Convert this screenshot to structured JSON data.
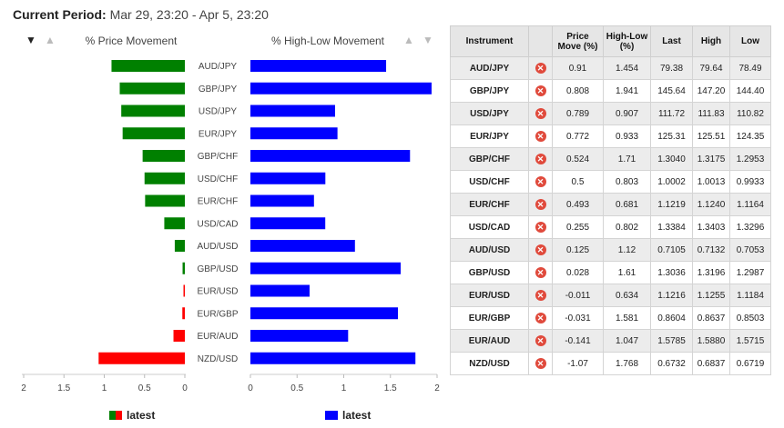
{
  "period": {
    "label": "Current Period:",
    "value": "Mar 29, 23:20 - Apr 5, 23:20"
  },
  "headers": {
    "price": "% Price Movement",
    "highlow": "% High-Low Movement"
  },
  "sort_glyphs": {
    "down": "▼",
    "up": "▲"
  },
  "table": {
    "columns": [
      "Instrument",
      "",
      "Price Move (%)",
      "High-Low (%)",
      "Last",
      "High",
      "Low"
    ],
    "remove_glyph": "✕",
    "rows": [
      [
        "AUD/JPY",
        "0.91",
        "1.454",
        "79.38",
        "79.64",
        "78.49"
      ],
      [
        "GBP/JPY",
        "0.808",
        "1.941",
        "145.64",
        "147.20",
        "144.40"
      ],
      [
        "USD/JPY",
        "0.789",
        "0.907",
        "111.72",
        "111.83",
        "110.82"
      ],
      [
        "EUR/JPY",
        "0.772",
        "0.933",
        "125.31",
        "125.51",
        "124.35"
      ],
      [
        "GBP/CHF",
        "0.524",
        "1.71",
        "1.3040",
        "1.3175",
        "1.2953"
      ],
      [
        "USD/CHF",
        "0.5",
        "0.803",
        "1.0002",
        "1.0013",
        "0.9933"
      ],
      [
        "EUR/CHF",
        "0.493",
        "0.681",
        "1.1219",
        "1.1240",
        "1.1164"
      ],
      [
        "USD/CAD",
        "0.255",
        "0.802",
        "1.3384",
        "1.3403",
        "1.3296"
      ],
      [
        "AUD/USD",
        "0.125",
        "1.12",
        "0.7105",
        "0.7132",
        "0.7053"
      ],
      [
        "GBP/USD",
        "0.028",
        "1.61",
        "1.3036",
        "1.3196",
        "1.2987"
      ],
      [
        "EUR/USD",
        "-0.011",
        "0.634",
        "1.1216",
        "1.1255",
        "1.1184"
      ],
      [
        "EUR/GBP",
        "-0.031",
        "1.581",
        "0.8604",
        "0.8637",
        "0.8503"
      ],
      [
        "EUR/AUD",
        "-0.141",
        "1.047",
        "1.5785",
        "1.5880",
        "1.5715"
      ],
      [
        "NZD/USD",
        "-1.07",
        "1.768",
        "0.6732",
        "0.6837",
        "0.6719"
      ]
    ]
  },
  "chart_data": [
    {
      "type": "bar",
      "orientation": "horizontal",
      "title": "% Price Movement",
      "categories": [
        "AUD/JPY",
        "GBP/JPY",
        "USD/JPY",
        "EUR/JPY",
        "GBP/CHF",
        "USD/CHF",
        "EUR/CHF",
        "USD/CAD",
        "AUD/USD",
        "GBP/USD",
        "EUR/USD",
        "EUR/GBP",
        "EUR/AUD",
        "NZD/USD"
      ],
      "series": [
        {
          "name": "latest",
          "values": [
            0.91,
            0.808,
            0.789,
            0.772,
            0.524,
            0.5,
            0.493,
            0.255,
            0.125,
            0.028,
            -0.011,
            -0.031,
            -0.141,
            -1.07
          ]
        }
      ],
      "xlim": [
        2,
        0
      ],
      "x_ticks": [
        "2",
        "1.5",
        "1",
        "0.5",
        "0"
      ],
      "colors": {
        "positive": "#008000",
        "negative": "#ff0000"
      },
      "legend": "bottom"
    },
    {
      "type": "bar",
      "orientation": "horizontal",
      "title": "% High-Low Movement",
      "categories": [
        "AUD/JPY",
        "GBP/JPY",
        "USD/JPY",
        "EUR/JPY",
        "GBP/CHF",
        "USD/CHF",
        "EUR/CHF",
        "USD/CAD",
        "AUD/USD",
        "GBP/USD",
        "EUR/USD",
        "EUR/GBP",
        "EUR/AUD",
        "NZD/USD"
      ],
      "series": [
        {
          "name": "latest",
          "values": [
            1.454,
            1.941,
            0.907,
            0.933,
            1.71,
            0.803,
            0.681,
            0.802,
            1.12,
            1.61,
            0.634,
            1.581,
            1.047,
            1.768
          ]
        }
      ],
      "xlim": [
        0,
        2
      ],
      "x_ticks": [
        "0",
        "0.5",
        "1",
        "1.5",
        "2"
      ],
      "colors": {
        "bar": "#0000ff"
      },
      "legend": "bottom"
    }
  ]
}
